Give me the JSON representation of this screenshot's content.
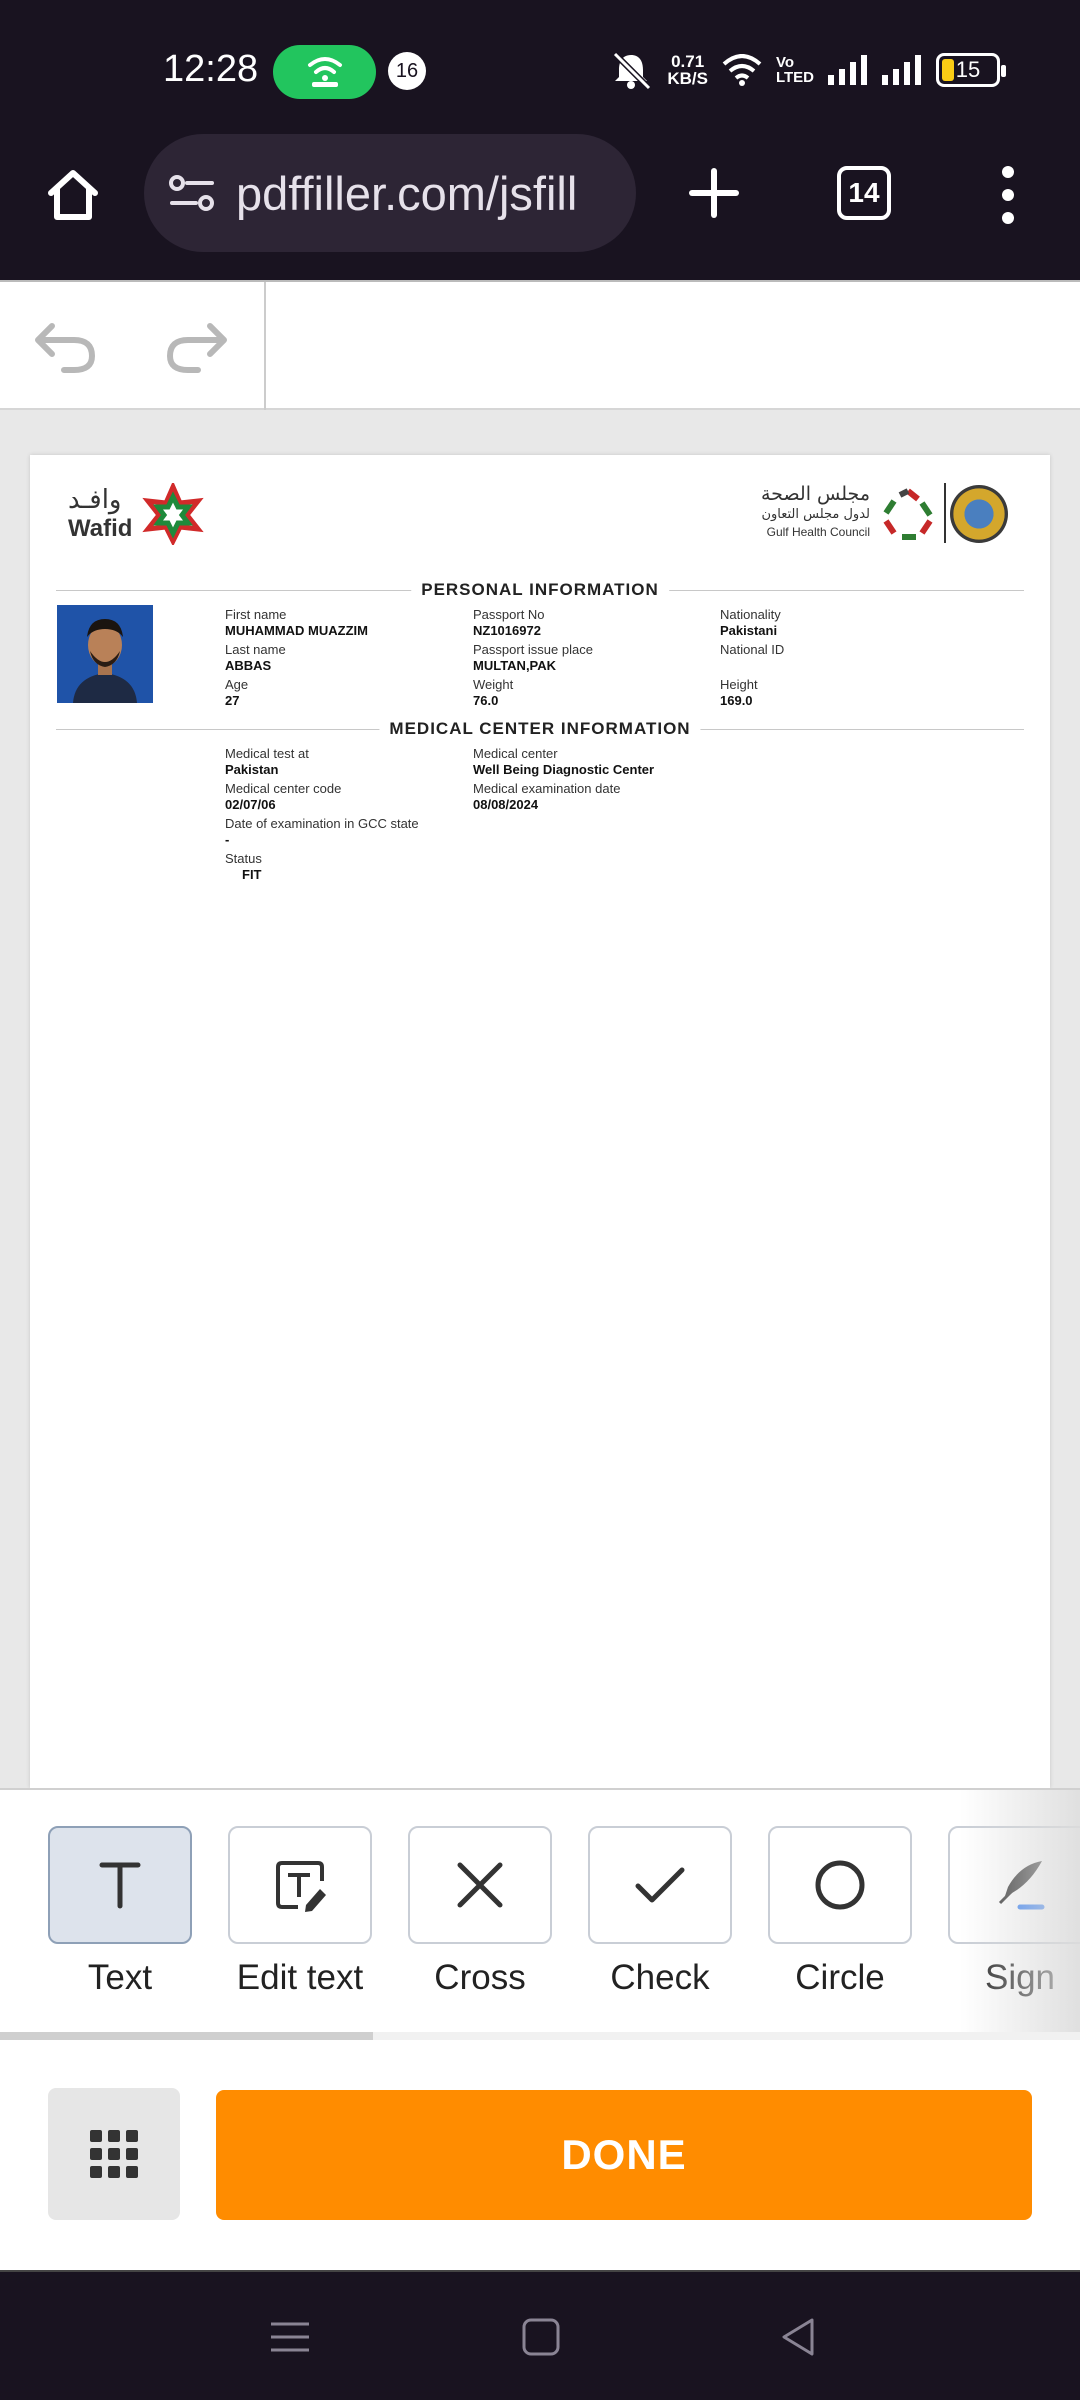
{
  "status_bar": {
    "time": "12:28",
    "notification_count": "16",
    "net_speed_value": "0.71",
    "net_speed_unit": "KB/S",
    "volte_top": "Vo",
    "volte_bottom": "LTED",
    "battery": "15",
    "hotspot_color": "#22c55e",
    "icons": [
      "hotspot-icon",
      "mute-icon",
      "wifi-icon",
      "signal-icon",
      "signal-icon",
      "battery-icon"
    ]
  },
  "browser": {
    "url": "pdffiller.com/jsfill",
    "tab_count": "14",
    "icons": [
      "home-icon",
      "site-settings-icon",
      "new-tab-icon",
      "tabs-icon",
      "menu-icon"
    ]
  },
  "editor": {
    "icons": [
      "undo-icon",
      "redo-icon"
    ]
  },
  "document": {
    "logo_left": {
      "arabic": "وافـد",
      "english": "Wafid"
    },
    "logo_right": {
      "arabic_1": "مجلس الصحة",
      "arabic_2": "لدول مجلس التعاون",
      "english": "Gulf Health Council"
    },
    "personal_title": "PERSONAL INFORMATION",
    "medical_title": "MEDICAL CENTER INFORMATION",
    "personal": {
      "first_name_label": "First name",
      "first_name": "MUHAMMAD MUAZZIM",
      "last_name_label": "Last name",
      "last_name": "ABBAS",
      "age_label": "Age",
      "age": "27",
      "passport_label": "Passport No",
      "passport": "NZ1016972",
      "passport_place_label": "Passport issue place",
      "passport_place": "MULTAN,PAK",
      "weight_label": "Weight",
      "weight": "76.0",
      "nationality_label": "Nationality",
      "nationality": "Pakistani",
      "national_id_label": "National ID",
      "height_label": "Height",
      "height": "169.0"
    },
    "medical": {
      "test_at_label": "Medical test at",
      "test_at": "Pakistan",
      "center_code_label": "Medical center code",
      "center_code": "02/07/06",
      "gcc_date_label": "Date of examination in GCC state",
      "gcc_date": "-",
      "status_label": "Status",
      "status": "FIT",
      "center_label": "Medical center",
      "center": "Well Being Diagnostic Center",
      "exam_date_label": "Medical examination date",
      "exam_date": "08/08/2024"
    }
  },
  "tools": [
    {
      "label": "Text",
      "icon": "text-icon",
      "active": true
    },
    {
      "label": "Edit text",
      "icon": "edit-text-icon",
      "active": false
    },
    {
      "label": "Cross",
      "icon": "cross-icon",
      "active": false
    },
    {
      "label": "Check",
      "icon": "check-icon",
      "active": false
    },
    {
      "label": "Circle",
      "icon": "circle-icon",
      "active": false
    },
    {
      "label": "Sign",
      "icon": "sign-icon",
      "active": false
    }
  ],
  "actions": {
    "done_label": "DONE",
    "done_color": "#ff8c00",
    "icons": [
      "grid-menu-icon"
    ]
  },
  "nav": {
    "icons": [
      "recents-icon",
      "home-square-icon",
      "back-icon"
    ]
  }
}
